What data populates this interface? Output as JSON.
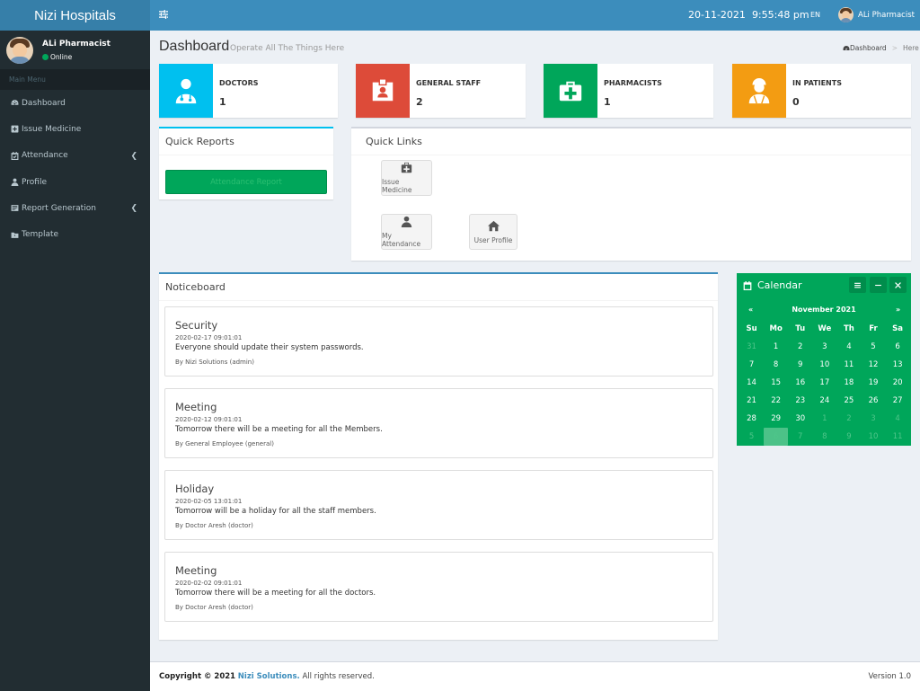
{
  "app": {
    "brand": "Nizi Hospitals"
  },
  "user": {
    "name": "ALi Pharmacist",
    "status": "Online"
  },
  "sidebar": {
    "header": "Main Menu",
    "items": [
      {
        "label": "Dashboard",
        "icon": "dashboard-icon"
      },
      {
        "label": "Issue Medicine",
        "icon": "plus-square-icon"
      },
      {
        "label": "Attendance",
        "icon": "calendar-check-icon",
        "expandable": true
      },
      {
        "label": "Profile",
        "icon": "user-icon"
      },
      {
        "label": "Report Generation",
        "icon": "report-icon",
        "expandable": true
      },
      {
        "label": "Template",
        "icon": "folder-icon"
      }
    ]
  },
  "topbar": {
    "date": "20-11-2021",
    "time": "9:55:48 pm",
    "lang": "EN",
    "user": "ALi Pharmacist"
  },
  "page": {
    "title": "Dashboard",
    "subtitle": "Operate All The Things Here",
    "breadcrumb_home": "Dashboard",
    "breadcrumb_here": "Here"
  },
  "stats": [
    {
      "label": "DOCTORS",
      "value": "1",
      "color": "#00c0ef",
      "icon": "doctor-icon"
    },
    {
      "label": "GENERAL STAFF",
      "value": "2",
      "color": "#dd4b39",
      "icon": "id-badge-icon"
    },
    {
      "label": "PHARMACISTS",
      "value": "1",
      "color": "#00a65a",
      "icon": "medkit-icon"
    },
    {
      "label": "IN PATIENTS",
      "value": "0",
      "color": "#f39c12",
      "icon": "patient-icon"
    }
  ],
  "quick_reports": {
    "title": "Quick Reports",
    "button": "Attendance Report"
  },
  "quick_links": {
    "title": "Quick Links",
    "items": [
      {
        "label": "Issue Medicine",
        "icon": "medkit-icon"
      },
      {
        "label": "My Attendance",
        "icon": "user-icon"
      },
      {
        "label": "User Profile",
        "icon": "home-icon"
      }
    ]
  },
  "noticeboard": {
    "title": "Noticeboard",
    "items": [
      {
        "title": "Security",
        "date": "2020-02-17 09:01:01",
        "body": "Everyone should update their system passwords.",
        "by": "By Nizi Solutions (admin)"
      },
      {
        "title": "Meeting",
        "date": "2020-02-12 09:01:01",
        "body": "Tomorrow there will be a meeting for all the Members.",
        "by": "By General Employee (general)"
      },
      {
        "title": "Holiday",
        "date": "2020-02-05 13:01:01",
        "body": "Tomorrow will be a holiday for all the staff members.",
        "by": "By Doctor Aresh (doctor)"
      },
      {
        "title": "Meeting",
        "date": "2020-02-02 09:01:01",
        "body": "Tomorrow there will be a meeting for all the doctors.",
        "by": "By Doctor Aresh (doctor)"
      }
    ]
  },
  "calendar": {
    "title": "Calendar",
    "month": "November 2021",
    "prev": "«",
    "next": "»",
    "weekdays": [
      "Su",
      "Mo",
      "Tu",
      "We",
      "Th",
      "Fr",
      "Sa"
    ],
    "days": [
      [
        "31",
        "1",
        "2",
        "3",
        "4",
        "5",
        "6"
      ],
      [
        "7",
        "8",
        "9",
        "10",
        "11",
        "12",
        "13"
      ],
      [
        "14",
        "15",
        "16",
        "17",
        "18",
        "19",
        "20"
      ],
      [
        "21",
        "22",
        "23",
        "24",
        "25",
        "26",
        "27"
      ],
      [
        "28",
        "29",
        "30",
        "1",
        "2",
        "3",
        "4"
      ],
      [
        "5",
        "6",
        "7",
        "8",
        "9",
        "10",
        "11"
      ]
    ],
    "selected": {
      "row": 5,
      "col": 1
    },
    "muted": [
      [
        0,
        0
      ],
      [
        4,
        3
      ],
      [
        4,
        4
      ],
      [
        4,
        5
      ],
      [
        4,
        6
      ],
      [
        5,
        0
      ],
      [
        5,
        1
      ],
      [
        5,
        2
      ],
      [
        5,
        3
      ],
      [
        5,
        4
      ],
      [
        5,
        5
      ],
      [
        5,
        6
      ]
    ]
  },
  "footer": {
    "copyright": "Copyright © 2021",
    "company": "Nizi Solutions.",
    "rights": "All rights reserved.",
    "version": "Version 1.0"
  }
}
